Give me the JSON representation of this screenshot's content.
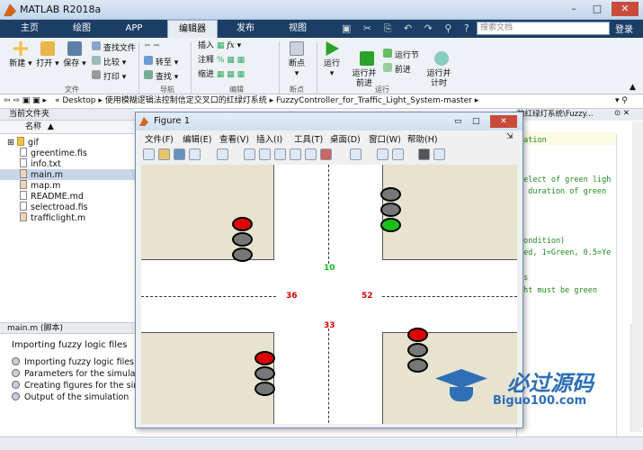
{
  "window": {
    "title": "MATLAB R2018a"
  },
  "tabs": [
    {
      "label": "主页"
    },
    {
      "label": "绘图"
    },
    {
      "label": "APP"
    },
    {
      "label": "编辑器",
      "active": true
    },
    {
      "label": "发布"
    },
    {
      "label": "视图"
    }
  ],
  "search": {
    "placeholder": "搜索文档"
  },
  "login": "登录",
  "ribbon": {
    "file": {
      "new": "新建",
      "open": "打开",
      "save": "保存",
      "find_files": "查找文件",
      "compare": "比较",
      "print": "打印",
      "group": "文件"
    },
    "nav": {
      "goto": "转至",
      "find": "查找",
      "group": "导航"
    },
    "edit": {
      "insert": "插入",
      "comment": "注释",
      "indent": "缩进",
      "group": "编辑"
    },
    "breakpoints": {
      "label": "断点",
      "group": "断点"
    },
    "run": {
      "run": "运行",
      "run_advance": "运行并\n前进",
      "run_section": "运行节",
      "advance": "前进",
      "run_time": "运行并\n计时",
      "group": "运行"
    }
  },
  "address": {
    "parts": [
      "Desktop",
      "使用模糊逻辑法控制信定交叉口的红绿灯系统",
      "FuzzyController_for_Traffic_Light_System-master"
    ]
  },
  "current_folder": {
    "header": "当前文件夹",
    "column": "名称",
    "files": [
      "gif",
      "greentime.fis",
      "info.txt",
      "main.m",
      "map.m",
      "README.md",
      "selectroad.fis",
      "trafficlight.m"
    ],
    "selected": "main.m"
  },
  "details": {
    "header": "main.m (脚本)",
    "title": "Importing fuzzy logic files",
    "items": [
      "Importing fuzzy logic files",
      "Parameters for the simulatio",
      "Creating figures for the sim",
      "Output of the simulation"
    ]
  },
  "editor": {
    "tab": "的红绿灯系统\\Fuzzy...",
    "lines": [
      "ration",
      "select of green ligh",
      "r duration of green",
      "condition)",
      "ked, 1=Green, 0.5=Ye",
      "ts",
      "ght must be green"
    ]
  },
  "figure": {
    "title": "Figure 1",
    "menu": [
      "文件(F)",
      "编辑(E)",
      "查看(V)",
      "插入(I)",
      "工具(T)",
      "桌面(D)",
      "窗口(W)",
      "帮助(H)"
    ],
    "counts": {
      "north": "10",
      "west": "36",
      "east": "52",
      "south": "33"
    },
    "colors": {
      "green": "#18c018",
      "red": "#dd0000",
      "off": "#777777"
    }
  },
  "watermark": {
    "main": "必过源码",
    "sub": "Biguo100.com"
  }
}
